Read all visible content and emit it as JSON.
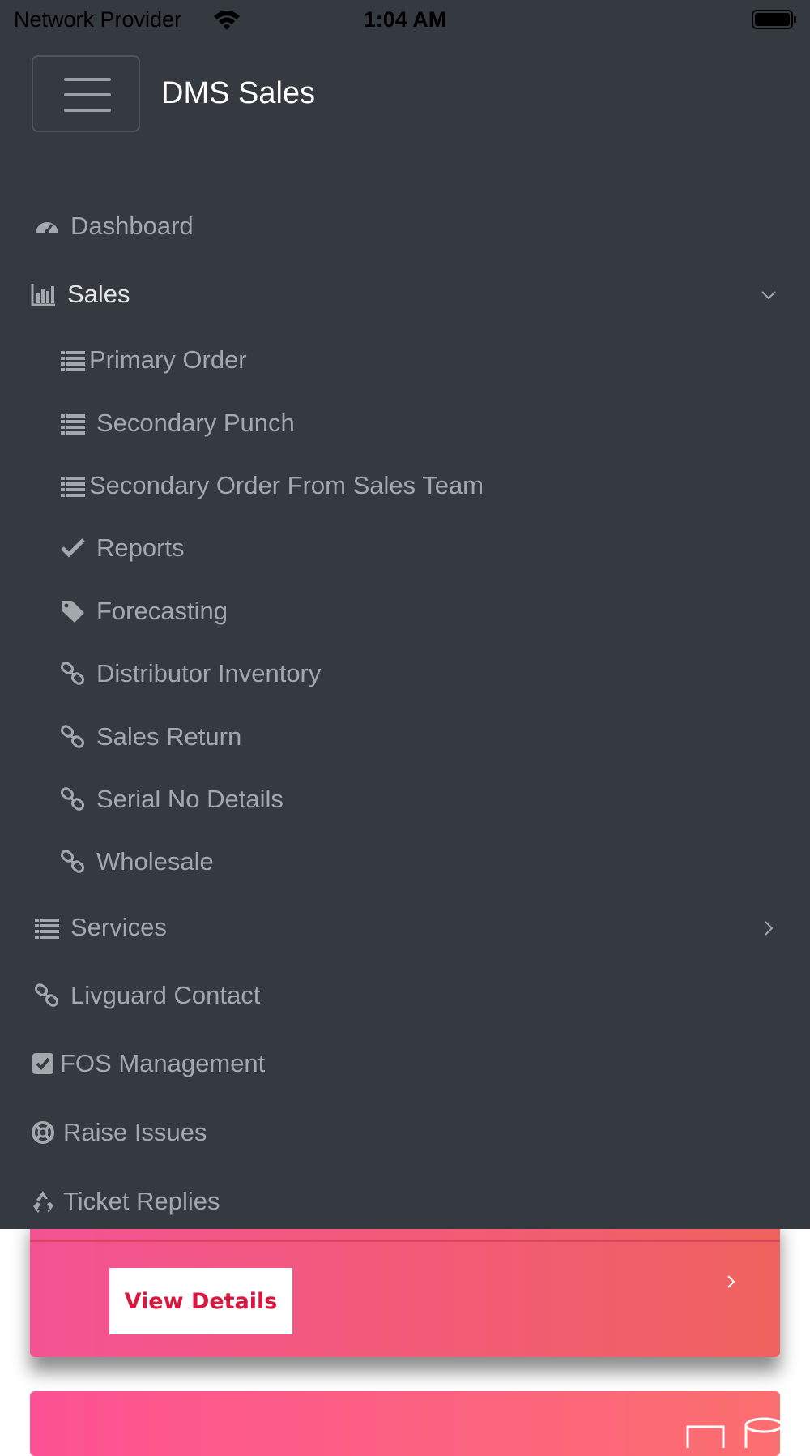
{
  "status_bar": {
    "carrier": "Network Provider",
    "time": "1:04 AM"
  },
  "header": {
    "brand": "DMS Sales"
  },
  "menu": {
    "dashboard": "Dashboard",
    "sales": "Sales",
    "sales_items": [
      {
        "label": "Primary Order",
        "icon": "list-icon"
      },
      {
        "label": "Secondary Punch",
        "icon": "list-icon"
      },
      {
        "label": "Secondary Order From Sales Team",
        "icon": "list-icon"
      },
      {
        "label": "Reports",
        "icon": "check-icon"
      },
      {
        "label": "Forecasting",
        "icon": "tag-icon"
      },
      {
        "label": "Distributor Inventory",
        "icon": "link-icon"
      },
      {
        "label": "Sales Return",
        "icon": "link-icon"
      },
      {
        "label": "Serial No Details",
        "icon": "link-icon"
      },
      {
        "label": "Wholesale",
        "icon": "link-icon"
      }
    ],
    "services": "Services",
    "livguard_contact": "Livguard Contact",
    "fos_management": "FOS Management",
    "raise_issues": "Raise Issues",
    "ticket_replies": "Ticket Replies"
  },
  "content": {
    "view_details": "View Details"
  },
  "colors": {
    "drawer_bg": "#343a40",
    "menu_text": "#a3a8ad",
    "card_gradient_start": "#f45393",
    "card_gradient_end": "#f0625f",
    "button_text": "#d8183f"
  }
}
